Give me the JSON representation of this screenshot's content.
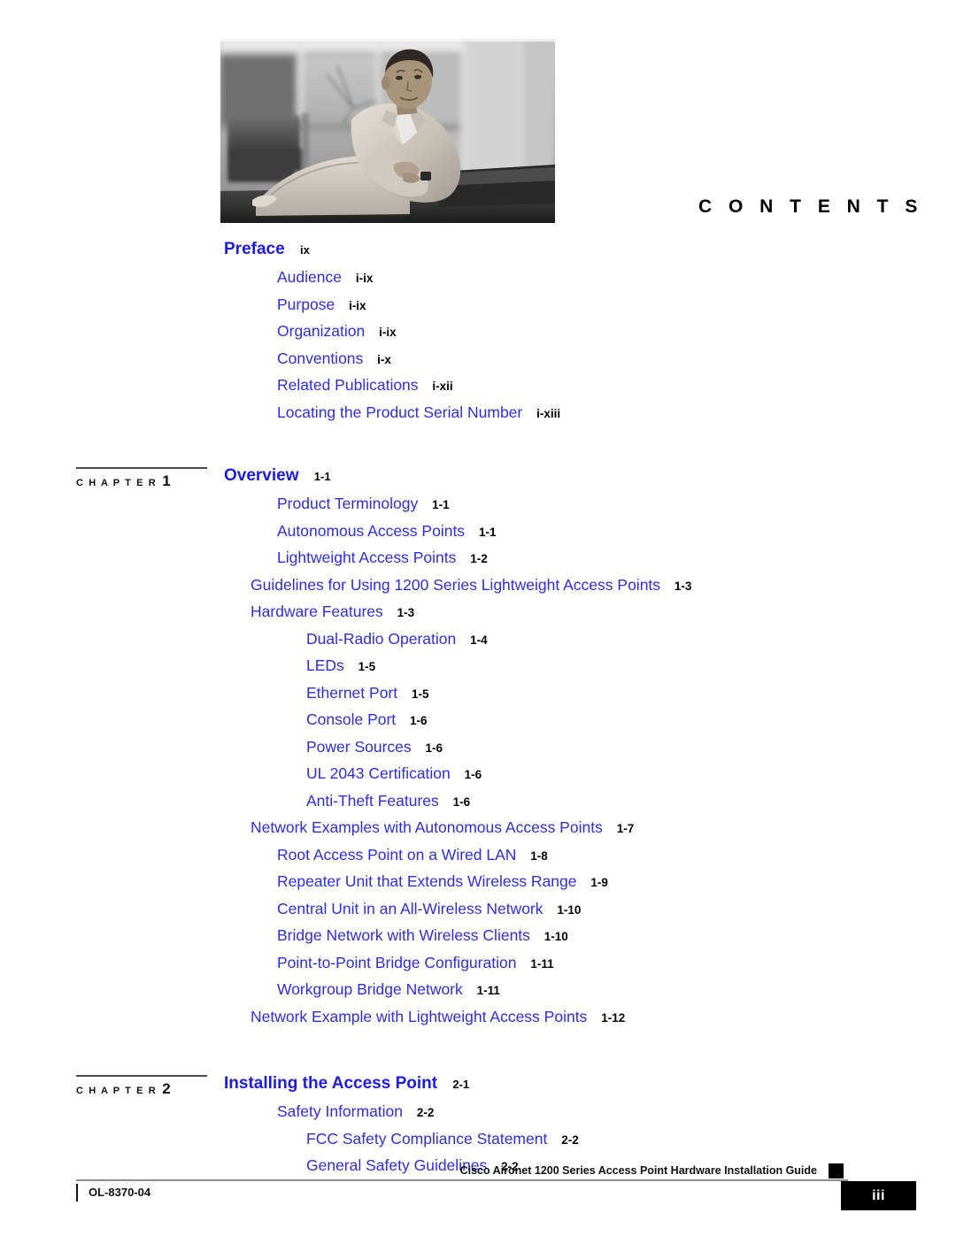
{
  "page": {
    "heading": "C O N T E N T S",
    "hero_photo_alt": "man-seated-in-office-lounge-photo"
  },
  "toc": [
    {
      "level": "title",
      "label": "Preface",
      "page": "ix"
    },
    {
      "level": 2,
      "label": "Audience",
      "page": "i-ix"
    },
    {
      "level": 2,
      "label": "Purpose",
      "page": "i-ix"
    },
    {
      "level": 2,
      "label": "Organization",
      "page": "i-ix"
    },
    {
      "level": 2,
      "label": "Conventions",
      "page": "i-x"
    },
    {
      "level": 2,
      "label": "Related Publications",
      "page": "i-xii"
    },
    {
      "level": 2,
      "label": "Locating the Product Serial Number",
      "page": "i-xiii"
    }
  ],
  "chapters": [
    {
      "marker_word": "C H A P T E R",
      "marker_number": "1",
      "title": {
        "label": "Overview",
        "page": "1-1"
      },
      "entries": [
        {
          "level": 2,
          "label": "Product Terminology",
          "page": "1-1"
        },
        {
          "level": 2,
          "label": "Autonomous Access Points",
          "page": "1-1"
        },
        {
          "level": 2,
          "label": "Lightweight Access Points",
          "page": "1-2"
        },
        {
          "level": 1,
          "label": "Guidelines for Using 1200 Series Lightweight Access Points",
          "page": "1-3"
        },
        {
          "level": 1,
          "label": "Hardware Features",
          "page": "1-3"
        },
        {
          "level": 3,
          "label": "Dual-Radio Operation",
          "page": "1-4"
        },
        {
          "level": 3,
          "label": "LEDs",
          "page": "1-5"
        },
        {
          "level": 3,
          "label": "Ethernet Port",
          "page": "1-5"
        },
        {
          "level": 3,
          "label": "Console Port",
          "page": "1-6"
        },
        {
          "level": 3,
          "label": "Power Sources",
          "page": "1-6"
        },
        {
          "level": 3,
          "label": "UL 2043 Certification",
          "page": "1-6"
        },
        {
          "level": 3,
          "label": "Anti-Theft Features",
          "page": "1-6"
        },
        {
          "level": 1,
          "label": "Network Examples with Autonomous Access Points",
          "page": "1-7"
        },
        {
          "level": 2,
          "label": "Root Access Point on a Wired LAN",
          "page": "1-8"
        },
        {
          "level": 2,
          "label": "Repeater Unit that Extends Wireless Range",
          "page": "1-9"
        },
        {
          "level": 2,
          "label": "Central Unit in an All-Wireless Network",
          "page": "1-10"
        },
        {
          "level": 2,
          "label": "Bridge Network with Wireless Clients",
          "page": "1-10"
        },
        {
          "level": 2,
          "label": "Point-to-Point Bridge Configuration",
          "page": "1-11"
        },
        {
          "level": 2,
          "label": "Workgroup Bridge Network",
          "page": "1-11"
        },
        {
          "level": 1,
          "label": "Network Example with Lightweight Access Points",
          "page": "1-12"
        }
      ]
    },
    {
      "marker_word": "C H A P T E R",
      "marker_number": "2",
      "title": {
        "label": "Installing the Access Point",
        "page": "2-1"
      },
      "entries": [
        {
          "level": 2,
          "label": "Safety Information",
          "page": "2-2"
        },
        {
          "level": 3,
          "label": "FCC Safety Compliance Statement",
          "page": "2-2"
        },
        {
          "level": 3,
          "label": "General Safety Guidelines",
          "page": "2-2"
        }
      ]
    }
  ],
  "footer": {
    "guide_title": "Cisco Aironet 1200 Series Access Point Hardware Installation Guide",
    "doc_id": "OL-8370-04",
    "page_number": "iii"
  },
  "colors": {
    "link_blue": "#2e2ee0",
    "title_blue": "#1c1ce0",
    "page_black": "#000000",
    "footer_box": "#000000"
  }
}
